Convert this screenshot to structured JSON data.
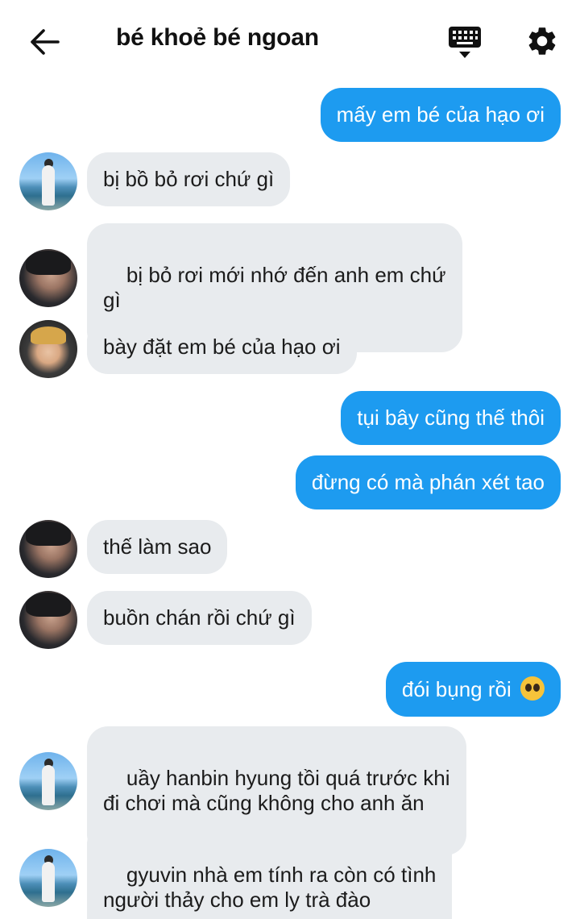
{
  "header": {
    "title": "bé khoẻ bé ngoan",
    "back_icon": "arrow-left-icon",
    "keyboard_icon": "keyboard-icon",
    "settings_icon": "gear-icon"
  },
  "colors": {
    "outgoing_bubble": "#1d9bf0",
    "incoming_bubble": "#e8ebee"
  },
  "messages": [
    {
      "side": "out",
      "text": "mấy em bé của hạo ơi"
    },
    {
      "side": "in",
      "avatar": "sea",
      "text": "bị bồ bỏ rơi chứ gì"
    },
    {
      "side": "in",
      "avatar": "dark",
      "text": "bị bỏ rơi mới nhớ đến anh em chứ\ngì"
    },
    {
      "side": "in",
      "avatar": "hood",
      "text": "bày đặt em bé của hạo ơi"
    },
    {
      "side": "out",
      "text": "tụi bây cũng thế thôi"
    },
    {
      "side": "out",
      "text": "đừng có mà phán xét tao"
    },
    {
      "side": "in",
      "avatar": "dark",
      "text": "thế làm sao"
    },
    {
      "side": "in",
      "avatar": "dark",
      "text": "buồn chán rồi chứ gì"
    },
    {
      "side": "out",
      "text": "đói bụng rồi",
      "emoji": "pleading-face-emoji"
    },
    {
      "side": "in",
      "avatar": "sea",
      "text": "uầy hanbin hyung tồi quá trước khi\nđi chơi mà cũng không cho anh ăn"
    },
    {
      "side": "in",
      "avatar": "sea",
      "text": "gyuvin nhà em tính ra còn có tình\nngười thảy cho em ly trà đào"
    }
  ]
}
